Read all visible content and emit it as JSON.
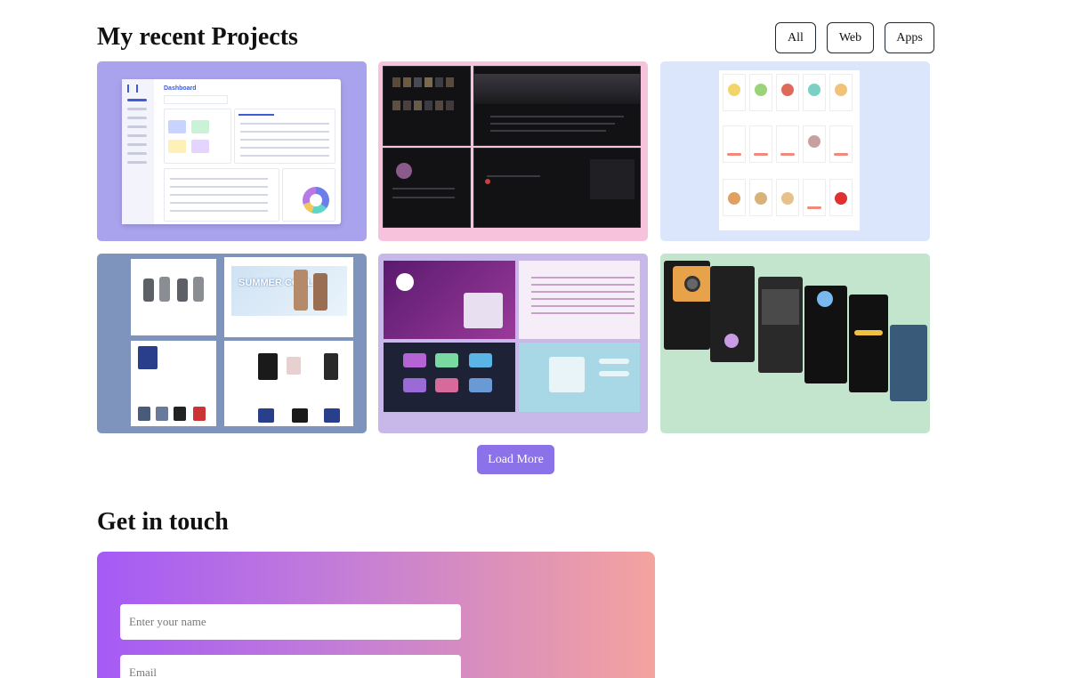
{
  "projects": {
    "title": "My recent Projects",
    "filters": {
      "all": "All",
      "web": "Web",
      "apps": "Apps"
    },
    "load_more": "Load More",
    "cards": [
      {
        "thumb": "dashboard-screenshot",
        "label": "Dashboard"
      },
      {
        "thumb": "music-app-screenshot",
        "label": ""
      },
      {
        "thumb": "food-app-mockups",
        "label": ""
      },
      {
        "thumb": "ecommerce-screenshot",
        "label": "SUMMER COOL"
      },
      {
        "thumb": "management-app-screenshot",
        "label": ""
      },
      {
        "thumb": "camera-app-screenshot",
        "label": ""
      }
    ]
  },
  "contact": {
    "title": "Get in touch",
    "name_placeholder": "Enter your name",
    "email_placeholder": "Email"
  },
  "colors": {
    "load_more_bg": "#8c72e8",
    "contact_gradient_start": "#a55af6",
    "contact_gradient_end": "#f4a39e"
  }
}
